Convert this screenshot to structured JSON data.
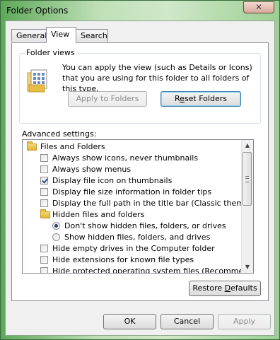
{
  "window": {
    "title": "Folder Options",
    "close_glyph": "✕"
  },
  "tabs": [
    {
      "label": "General",
      "active": false
    },
    {
      "label": "View",
      "active": true
    },
    {
      "label": "Search",
      "active": false
    }
  ],
  "folder_views": {
    "title": "Folder views",
    "description": "You can apply the view (such as Details or Icons) that you are using for this folder to all folders of this type.",
    "icon": "folder-views-icon",
    "apply_button": {
      "label": "Apply to Folders",
      "enabled": false
    },
    "reset_button": {
      "label_pre": "R",
      "label_u": "e",
      "label_post": "set Folders",
      "enabled": true
    }
  },
  "advanced": {
    "label": "Advanced settings:",
    "items": [
      {
        "kind": "folder",
        "label": "Files and Folders",
        "level": 0
      },
      {
        "kind": "checkbox",
        "label": "Always show icons, never thumbnails",
        "checked": false,
        "level": 1
      },
      {
        "kind": "checkbox",
        "label": "Always show menus",
        "checked": false,
        "level": 1
      },
      {
        "kind": "checkbox",
        "label": "Display file icon on thumbnails",
        "checked": true,
        "level": 1
      },
      {
        "kind": "checkbox",
        "label": "Display file size information in folder tips",
        "checked": false,
        "level": 1
      },
      {
        "kind": "checkbox",
        "label": "Display the full path in the title bar (Classic theme only)",
        "checked": false,
        "level": 1
      },
      {
        "kind": "folder",
        "label": "Hidden files and folders",
        "level": 1
      },
      {
        "kind": "radio",
        "label": "Don't show hidden files, folders, or drives",
        "checked": true,
        "level": 2
      },
      {
        "kind": "radio",
        "label": "Show hidden files, folders, and drives",
        "checked": false,
        "level": 2
      },
      {
        "kind": "checkbox",
        "label": "Hide empty drives in the Computer folder",
        "checked": false,
        "level": 1
      },
      {
        "kind": "checkbox",
        "label": "Hide extensions for known file types",
        "checked": false,
        "level": 1
      },
      {
        "kind": "checkbox",
        "label": "Hide protected operating system files (Recommended)",
        "checked": false,
        "level": 1
      }
    ]
  },
  "restore_button": {
    "label_pre": "Restore ",
    "label_u": "D",
    "label_post": "efaults"
  },
  "footer": {
    "ok": "OK",
    "cancel": "Cancel",
    "apply": "Apply",
    "apply_enabled": false
  }
}
